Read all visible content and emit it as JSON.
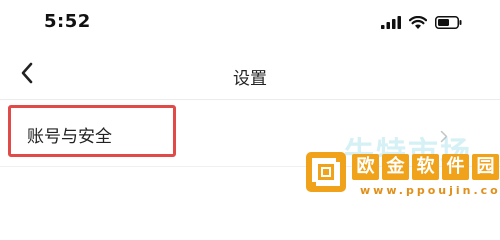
{
  "status_bar": {
    "time": "5:52",
    "icons": [
      "signal-icon",
      "wifi-icon",
      "battery-icon"
    ]
  },
  "nav": {
    "back_icon": "chevron-left-icon",
    "title": "设置"
  },
  "settings": {
    "items": [
      {
        "label": "账号与安全",
        "icon": "chevron-right-icon",
        "highlighted": true
      }
    ]
  },
  "watermark": {
    "top_text": "牛特市场",
    "chars": [
      "欧",
      "金",
      "软",
      "件",
      "园"
    ],
    "domain": "www.ppoujin.com"
  },
  "colors": {
    "highlight_border": "#e04b47",
    "watermark_orange": "#f0a21a"
  }
}
